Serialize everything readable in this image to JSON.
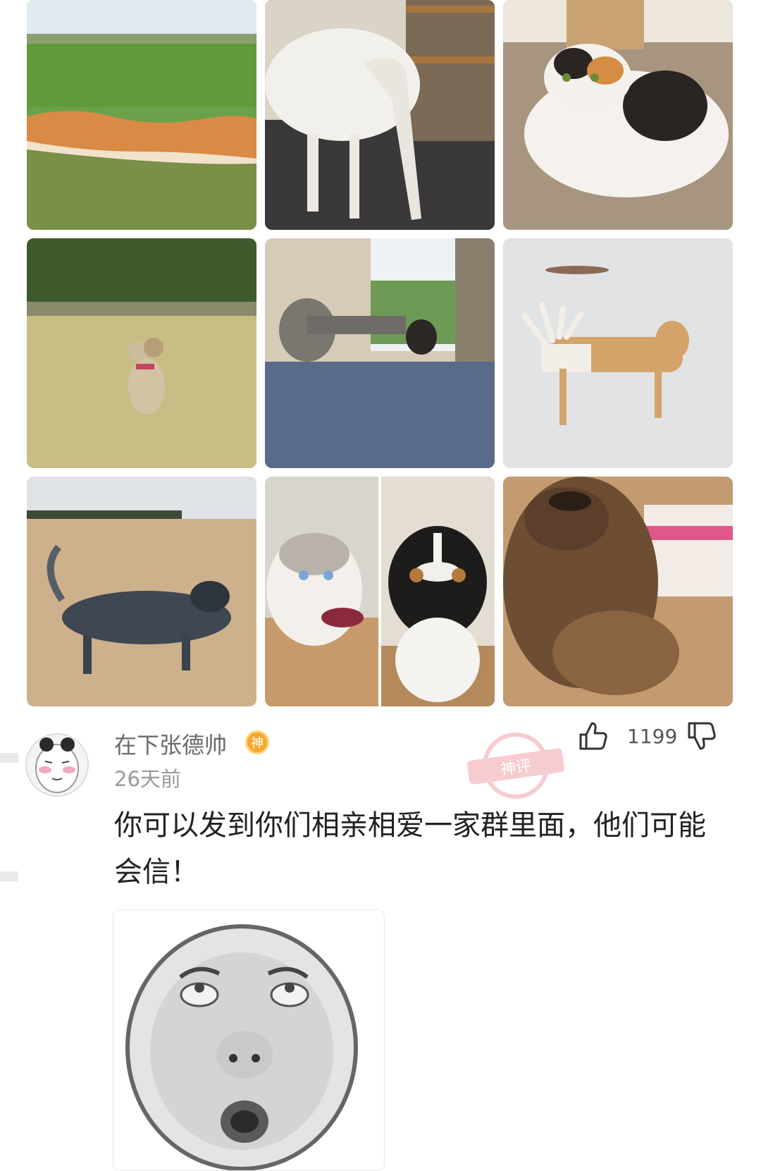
{
  "photos": [
    {
      "subject": "long-shiba-photo"
    },
    {
      "subject": "borzoi-photo"
    },
    {
      "subject": "calico-cat-photo"
    },
    {
      "subject": "two-headed-dog-photo"
    },
    {
      "subject": "long-dog-photo"
    },
    {
      "subject": "antler-dog-photo"
    },
    {
      "subject": "beach-dog-photo"
    },
    {
      "subject": "husky-and-bernese-photo"
    },
    {
      "subject": "upside-down-terrier-photo"
    }
  ],
  "comment": {
    "username": "在下张德帅",
    "badge_char": "神",
    "time": "26天前",
    "stamp_text": "神评",
    "likes": "1199",
    "text": "你可以发到你们相亲相爱一家群里面，他们可能会信！",
    "icons": {
      "like": "thumbs-up-icon",
      "dislike": "thumbs-down-icon",
      "badge": "god-badge-icon"
    }
  },
  "colors": {
    "badge": "#f7a92b",
    "stamp": "#f0a3ad",
    "text": "#222222",
    "meta": "#9a9a9a"
  }
}
